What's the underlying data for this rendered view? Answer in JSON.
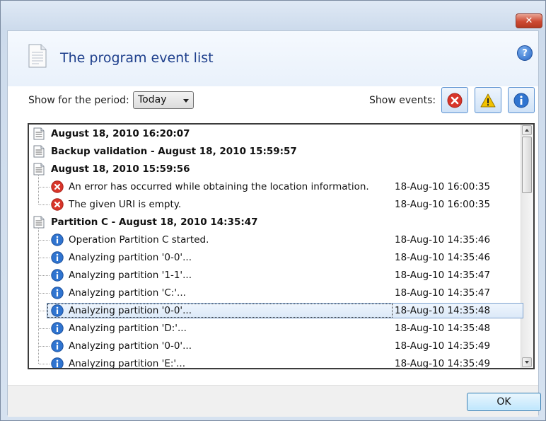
{
  "window": {
    "close_label": "✕"
  },
  "header": {
    "title": "The program event list",
    "help_label": "?"
  },
  "toolbar": {
    "period_label": "Show for the period:",
    "period_value": "Today",
    "events_label": "Show events:",
    "filters": [
      {
        "icon": "error-icon",
        "active": true
      },
      {
        "icon": "warning-icon",
        "active": true
      },
      {
        "icon": "info-icon",
        "active": true
      }
    ]
  },
  "events": [
    {
      "type": "group",
      "text": "August 18, 2010 16:20:07",
      "time": ""
    },
    {
      "type": "group",
      "text": "Backup validation - August 18, 2010 15:59:57",
      "time": ""
    },
    {
      "type": "group",
      "text": "August 18, 2010 15:59:56",
      "time": ""
    },
    {
      "type": "error",
      "text": "An error has occurred while obtaining the location information.",
      "time": "18-Aug-10 16:00:35"
    },
    {
      "type": "error",
      "text": "The given URI is empty.",
      "time": "18-Aug-10 16:00:35"
    },
    {
      "type": "group",
      "text": "Partition C - August 18, 2010 14:35:47",
      "time": ""
    },
    {
      "type": "info",
      "text": "Operation Partition C started.",
      "time": "18-Aug-10 14:35:46"
    },
    {
      "type": "info",
      "text": "Analyzing partition '0-0'...",
      "time": "18-Aug-10 14:35:46"
    },
    {
      "type": "info",
      "text": "Analyzing partition '1-1'...",
      "time": "18-Aug-10 14:35:47"
    },
    {
      "type": "info",
      "text": "Analyzing partition 'C:'...",
      "time": "18-Aug-10 14:35:47"
    },
    {
      "type": "info",
      "text": "Analyzing partition '0-0'...",
      "time": "18-Aug-10 14:35:48",
      "selected": true
    },
    {
      "type": "info",
      "text": "Analyzing partition 'D:'...",
      "time": "18-Aug-10 14:35:48"
    },
    {
      "type": "info",
      "text": "Analyzing partition '0-0'...",
      "time": "18-Aug-10 14:35:49"
    },
    {
      "type": "info",
      "text": "Analyzing partition 'E:'...",
      "time": "18-Aug-10 14:35:49"
    }
  ],
  "footer": {
    "ok_label": "OK"
  },
  "colors": {
    "title": "#1e3f8c",
    "error": "#d8352a",
    "warning": "#f2c200",
    "info": "#2f74d0"
  }
}
